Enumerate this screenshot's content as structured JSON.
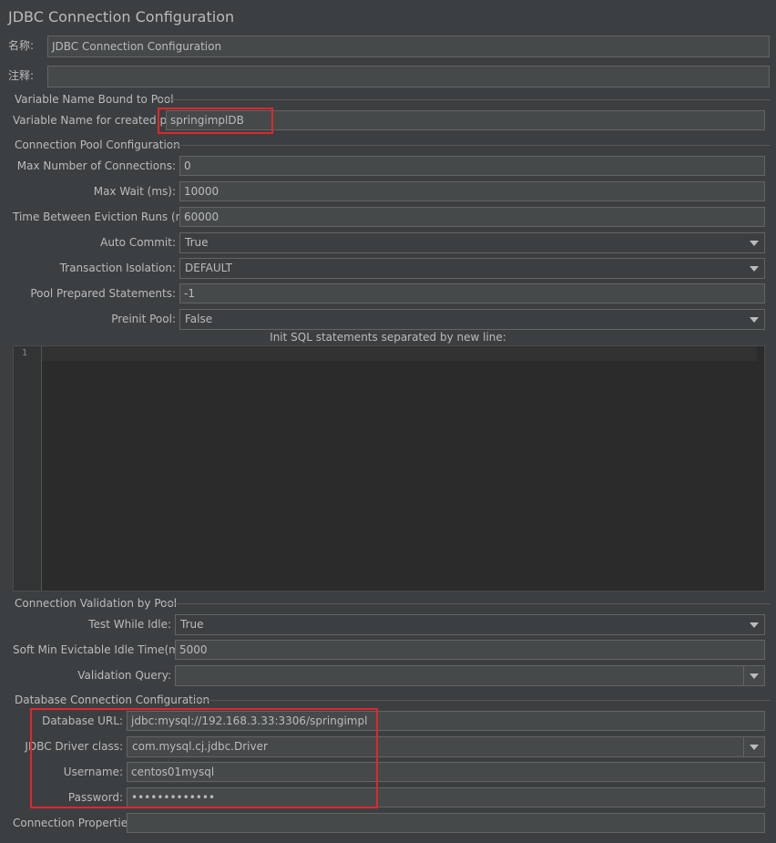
{
  "window": {
    "title": "JDBC Connection Configuration"
  },
  "general": {
    "name_label": "名称:",
    "name_value": "JDBC Connection Configuration",
    "comment_label": "注释:",
    "comment_value": ""
  },
  "pool_var": {
    "group_title": "Variable Name Bound to Pool",
    "var_label": "Variable Name for created pool:",
    "var_value": "springimplDB"
  },
  "pool_config": {
    "group_title": "Connection Pool Configuration",
    "max_conn_label": "Max Number of Connections:",
    "max_conn_value": "0",
    "max_wait_label": "Max Wait (ms):",
    "max_wait_value": "10000",
    "eviction_label": "Time Between Eviction Runs (ms):",
    "eviction_value": "60000",
    "auto_commit_label": "Auto Commit:",
    "auto_commit_value": "True",
    "isolation_label": "Transaction Isolation:",
    "isolation_value": "DEFAULT",
    "prepared_label": "Pool Prepared Statements:",
    "prepared_value": "-1",
    "preinit_label": "Preinit Pool:",
    "preinit_value": "False",
    "init_sql_label": "Init SQL statements separated by new line:",
    "init_sql_line_number": "1"
  },
  "validation": {
    "group_title": "Connection Validation by Pool",
    "test_idle_label": "Test While Idle:",
    "test_idle_value": "True",
    "soft_min_label": "Soft Min Evictable Idle Time(ms):",
    "soft_min_value": "5000",
    "query_label": "Validation Query:",
    "query_value": ""
  },
  "database": {
    "group_title": "Database Connection Configuration",
    "url_label": "Database URL:",
    "url_value": "jdbc:mysql://192.168.3.33:3306/springimpl",
    "driver_label": "JDBC Driver class:",
    "driver_value": "com.mysql.cj.jdbc.Driver",
    "username_label": "Username:",
    "username_value": "centos01mysql",
    "password_label": "Password:",
    "password_value": "•••••••••••••",
    "props_label": "Connection Properties:",
    "props_value": ""
  },
  "colors": {
    "background": "#3c3f41",
    "field_bg": "#45494a",
    "editor_bg": "#2b2b2b",
    "highlight": "#e0272d",
    "text": "#bbbbbb"
  }
}
